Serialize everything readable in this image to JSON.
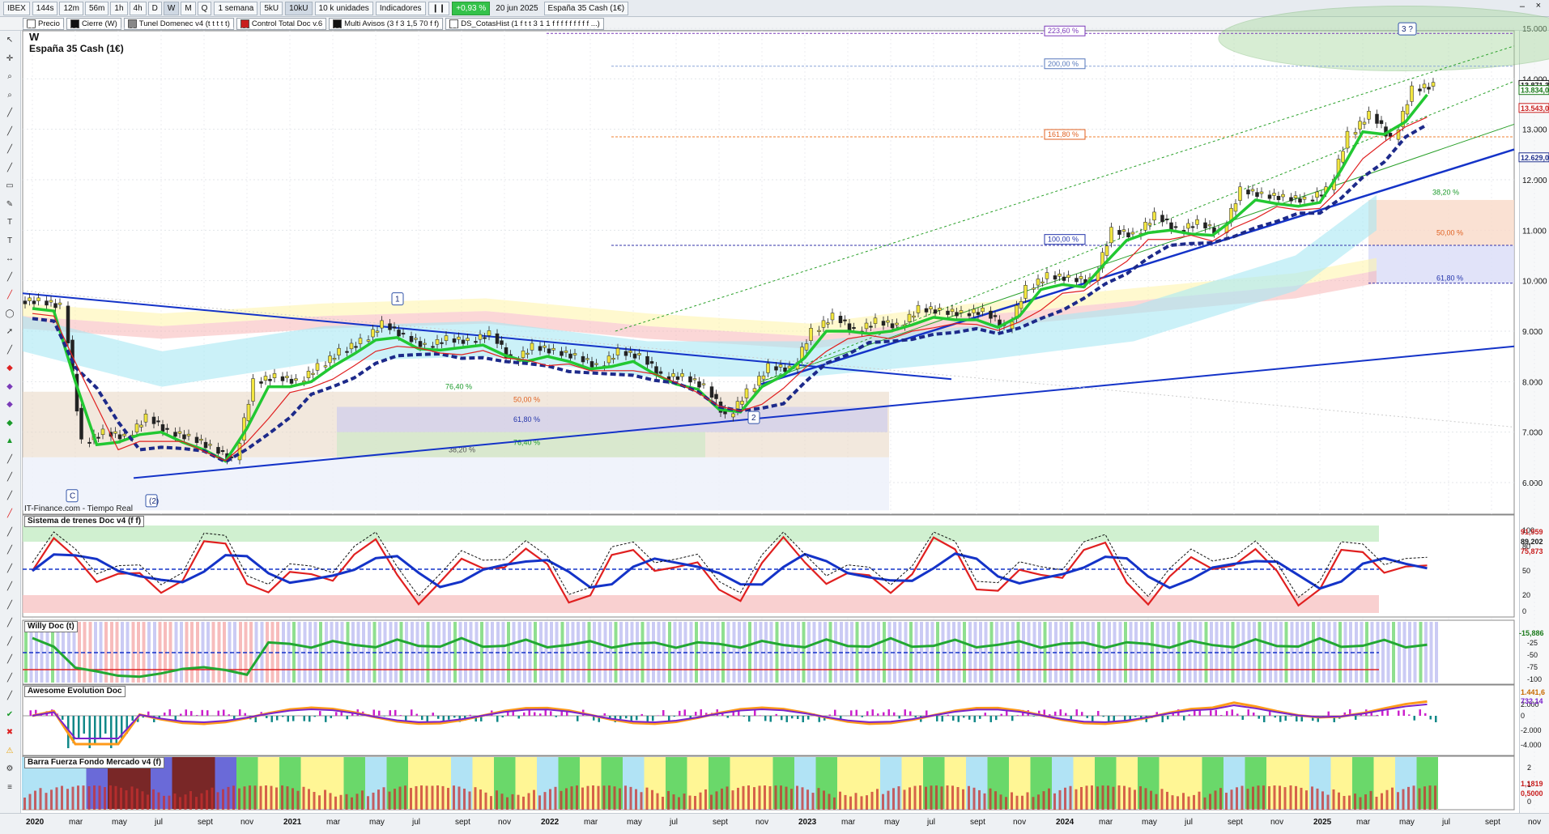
{
  "toolbar": {
    "symbol": "IBEX",
    "timeframes": [
      "144s",
      "12m",
      "56m",
      "1h",
      "4h",
      "D",
      "W",
      "M",
      "Q"
    ],
    "active_timeframe": "W",
    "period": "1 semana",
    "units_a": "5kU",
    "units_b": "10kU",
    "units_select": "10 k unidades",
    "indicators": "Indicadores",
    "change": "+0,93 %",
    "date": "20 jun 2025",
    "instrument": "España 35 Cash (1€)"
  },
  "indicator_bar": [
    {
      "label": "Precio",
      "color": "#ffffff"
    },
    {
      "label": "Cierre (W)",
      "color": "#111111"
    },
    {
      "label": "Tunel Domenec v4 (t t t t t)",
      "color": "#888888"
    },
    {
      "label": "Control Total Doc v.6",
      "color": "#c81e1e"
    },
    {
      "label": "Multi Avisos (3 f 3 1,5 70 f f)",
      "color": "#111111"
    },
    {
      "label": "DS_CotasHist (1 f t t 3 1 1 f f f f f f f f f ...)",
      "color": "#ffffff"
    }
  ],
  "chart_header": {
    "title": "W",
    "subtitle": "España 35 Cash (1€)",
    "source": "IT-Finance.com - Tiempo Real"
  },
  "panels": {
    "trenes": "Sistema de trenes Doc v4 (f f)",
    "willy": "Willy Doc (t)",
    "awesome": "Awesome Evolution Doc",
    "barra": "Barra Fuerza Fondo Mercado v4 (f)"
  },
  "fib_labels": [
    "223,60 %",
    "200,00 %",
    "161,80 %",
    "100,00 %",
    "38,20 %",
    "50,00 %",
    "61,80 %",
    "76,40 %",
    "50,00 %",
    "61,80 %",
    "76,40 %",
    "38,20 %"
  ],
  "wave_labels": [
    "1",
    "2",
    "3 ?",
    "C",
    "(2)"
  ],
  "price_axis": [
    "15.000",
    "14.000",
    "13.000",
    "12.000",
    "11.000",
    "10.000",
    "9.000",
    "8.000",
    "7.000",
    "6.000"
  ],
  "price_tags": [
    {
      "text": "13.871,3",
      "color": "#111111"
    },
    {
      "text": "13.834,0",
      "color": "#1a7a1a"
    },
    {
      "text": "13.543,0",
      "color": "#c81e1e"
    },
    {
      "text": "12.629,0",
      "color": "#1d2f8c"
    }
  ],
  "trenes_axis": [
    "100",
    "80",
    "50",
    "20",
    "0"
  ],
  "trenes_tags": [
    "91,959",
    "89,202",
    "75,873"
  ],
  "willy_axis": [
    "-25",
    "-50",
    "-75",
    "-100"
  ],
  "willy_tag": "-15,886",
  "awesome_axis": [
    "2.000",
    "0",
    "-2.000",
    "-4.000"
  ],
  "awesome_tags": [
    "1.441,6",
    "732,14"
  ],
  "barra_axis": [
    "2",
    "1",
    "0"
  ],
  "barra_tags": [
    "1,1819",
    "0,5000"
  ],
  "time_axis": [
    "2020",
    "mar",
    "may",
    "jul",
    "sept",
    "nov",
    "2021",
    "mar",
    "may",
    "jul",
    "sept",
    "nov",
    "2022",
    "mar",
    "may",
    "jul",
    "sept",
    "nov",
    "2023",
    "mar",
    "may",
    "jul",
    "sept",
    "nov",
    "2024",
    "mar",
    "may",
    "jul",
    "sept",
    "nov",
    "2025",
    "mar",
    "may",
    "jul",
    "sept",
    "nov"
  ],
  "chart_data": {
    "type": "candlestick",
    "instrument": "España 35 Cash (1€)",
    "interval": "W",
    "ylim": [
      5500,
      15000
    ],
    "x": [
      "2020-01",
      "2020-02",
      "2020-03",
      "2020-04",
      "2020-05",
      "2020-06",
      "2020-07",
      "2020-08",
      "2020-09",
      "2020-10",
      "2020-11",
      "2020-12",
      "2021-01",
      "2021-02",
      "2021-03",
      "2021-04",
      "2021-05",
      "2021-06",
      "2021-07",
      "2021-08",
      "2021-09",
      "2021-10",
      "2021-11",
      "2021-12",
      "2022-01",
      "2022-02",
      "2022-03",
      "2022-04",
      "2022-05",
      "2022-06",
      "2022-07",
      "2022-08",
      "2022-09",
      "2022-10",
      "2022-11",
      "2022-12",
      "2023-01",
      "2023-02",
      "2023-03",
      "2023-04",
      "2023-05",
      "2023-06",
      "2023-07",
      "2023-08",
      "2023-09",
      "2023-10",
      "2023-11",
      "2023-12",
      "2024-01",
      "2024-02",
      "2024-03",
      "2024-04",
      "2024-05",
      "2024-06",
      "2024-07",
      "2024-08",
      "2024-09",
      "2024-10",
      "2024-11",
      "2024-12",
      "2025-01",
      "2025-02",
      "2025-03",
      "2025-04",
      "2025-05",
      "2025-06"
    ],
    "close": [
      9600,
      9500,
      6800,
      7000,
      6900,
      7300,
      7000,
      6900,
      6700,
      6450,
      8000,
      8100,
      8000,
      8300,
      8600,
      8800,
      9150,
      8900,
      8700,
      8850,
      8800,
      8950,
      8400,
      8700,
      8600,
      8500,
      8300,
      8600,
      8500,
      8100,
      8100,
      7900,
      7300,
      7800,
      8300,
      8250,
      9000,
      9300,
      9000,
      9200,
      9100,
      9450,
      9400,
      9350,
      9400,
      9050,
      9850,
      10100,
      10050,
      10000,
      11000,
      10900,
      11300,
      11000,
      11150,
      10950,
      11800,
      11700,
      11650,
      11600,
      11800,
      12900,
      13300,
      12800,
      13800,
      13870
    ],
    "annotations": {
      "fib_levels_pct": [
        223.6,
        200,
        161.8,
        100,
        38.2,
        50,
        61.8,
        76.4
      ],
      "waves": [
        "C",
        "(2)",
        "1",
        "2",
        "3 ?"
      ]
    }
  }
}
